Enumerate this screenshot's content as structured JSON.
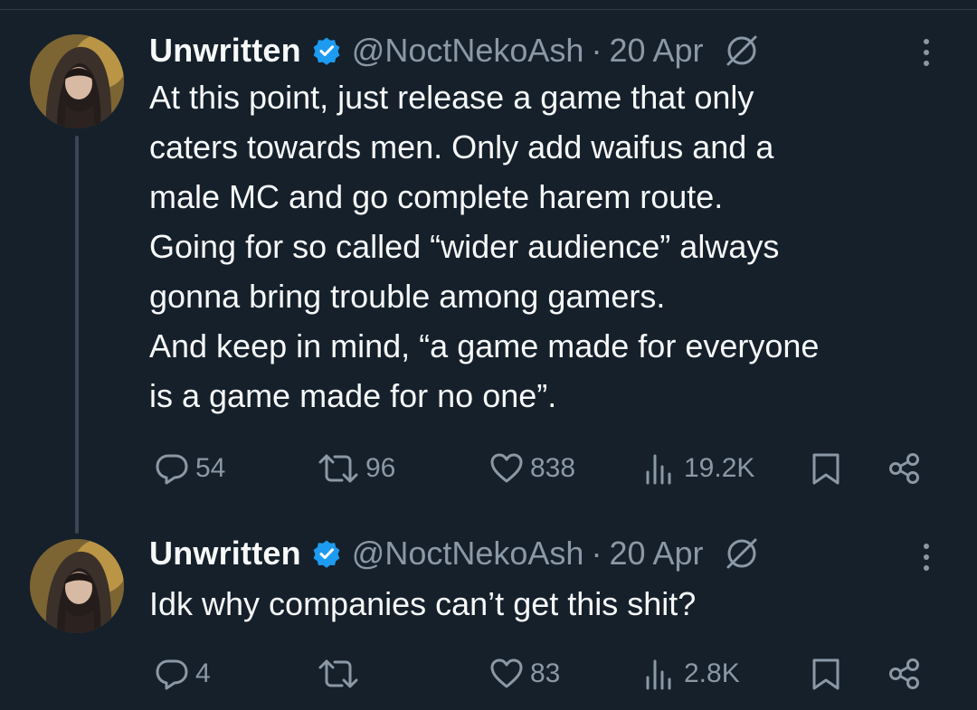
{
  "tweets": [
    {
      "author": {
        "name": "Unwritten",
        "handle": "@NoctNekoAsh",
        "verified": true
      },
      "separator": "·",
      "date": "20 Apr",
      "text": "At this point, just release a game that only\ncaters towards men. Only add waifus and a\nmale MC and go complete harem route.\nGoing for so called “wider audience” always\ngonna bring trouble among gamers.\nAnd keep in mind, “a game made for everyone\nis a game made for no one”.",
      "stats": {
        "replies": "54",
        "reposts": "96",
        "likes": "838",
        "views": "19.2K"
      }
    },
    {
      "author": {
        "name": "Unwritten",
        "handle": "@NoctNekoAsh",
        "verified": true
      },
      "separator": "·",
      "date": "20 Apr",
      "text": "Idk why companies can’t get this shit?",
      "stats": {
        "replies": "4",
        "reposts": "",
        "likes": "83",
        "views": "2.8K"
      }
    }
  ],
  "icons": [
    "verified-badge-icon",
    "grok-icon",
    "more-icon",
    "reply-icon",
    "repost-icon",
    "like-icon",
    "views-icon",
    "bookmark-icon",
    "share-icon"
  ],
  "colors": {
    "background": "#15202b",
    "text": "#f7f9f9",
    "secondary": "#8b98a5",
    "verified": "#1d9bf0",
    "thread_line": "#3a4654"
  }
}
